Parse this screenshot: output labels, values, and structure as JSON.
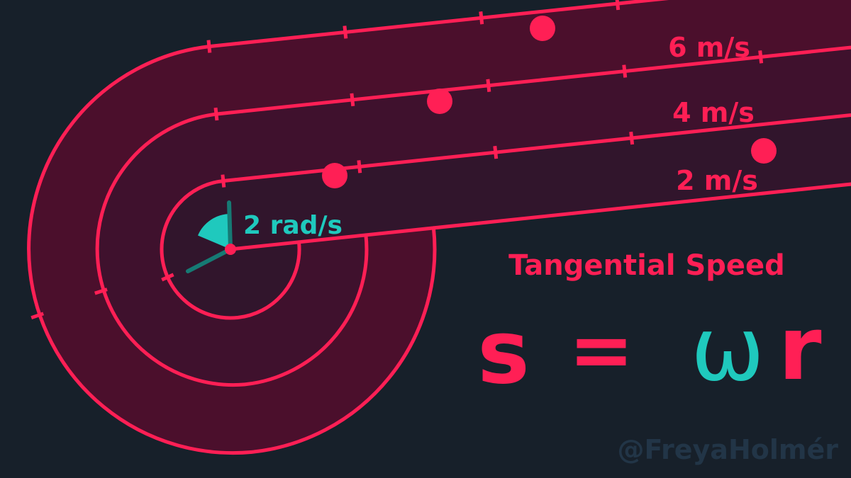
{
  "colors": {
    "background": "#17202a",
    "accent": "#ff1f55",
    "angular": "#1fc9bd",
    "angular_dark": "#167a74",
    "band_outer": "#4b0f2c",
    "band_middle": "#3f112d",
    "band_inner": "#31152c",
    "watermark": "#223547"
  },
  "speed_labels": [
    "6 m/s",
    "4 m/s",
    "2 m/s"
  ],
  "angular_label": "2 rad/s",
  "heading": "Tangential Speed",
  "formula": {
    "s": "s",
    "equals": "=",
    "omega": "ω",
    "r": "r"
  },
  "watermark": "@FreyaHolmér"
}
